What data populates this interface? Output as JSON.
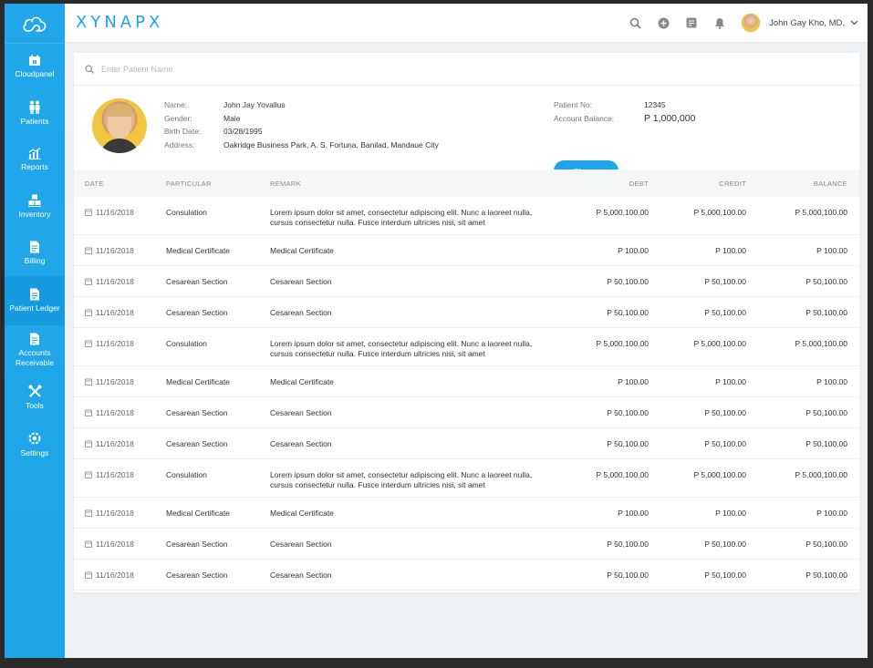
{
  "app": {
    "brand": "XYNAPX"
  },
  "sidebar": {
    "items": [
      {
        "label": "Cloudpanel",
        "icon": "cloudpanel-icon"
      },
      {
        "label": "Patients",
        "icon": "patients-icon"
      },
      {
        "label": "Reports",
        "icon": "reports-icon"
      },
      {
        "label": "Inventory",
        "icon": "inventory-icon"
      },
      {
        "label": "Billing",
        "icon": "billing-icon"
      },
      {
        "label": "Patient Ledger",
        "icon": "ledger-icon"
      },
      {
        "label": "Accounts Receivable",
        "icon": "receivable-icon"
      },
      {
        "label": "Tools",
        "icon": "tools-icon"
      },
      {
        "label": "Settings",
        "icon": "settings-icon"
      }
    ],
    "active": "Patient Ledger"
  },
  "header": {
    "user_name": "John Gay Kho, MD."
  },
  "search": {
    "placeholder": "Enter Patient Name"
  },
  "patient": {
    "name_label": "Name:",
    "name": "John Jay Yovallus",
    "gender_label": "Gender:",
    "gender": "Male",
    "birth_label": "Birth Date:",
    "birth_date": "03/28/1995",
    "address_label": "Address:",
    "address": "Oakridge Business Park, A. S. Fortuna, Banilad, Mandaue City",
    "patient_no_label": "Patient No:",
    "patient_no": "12345",
    "balance_label": "Account Balance:",
    "balance": "P 1,000,000",
    "charge_button": "Charge"
  },
  "ledger": {
    "columns": [
      "DATE",
      "PARTICULAR",
      "REMARK",
      "DEBT",
      "CREDIT",
      "BALANCE"
    ],
    "rows": [
      {
        "date": "11/16/2018",
        "particular": "Consulation",
        "remark": "Lorem ipsum dolor sit amet, consectetur adipiscing elit. Nunc a laoreet nulla, cursus consectetur nulla. Fusce interdum ultricies nisi, sit amet",
        "debt": "P 5,000,100.00",
        "credit": "P 5,000,100.00",
        "balance": "P 5,000,100.00"
      },
      {
        "date": "11/16/2018",
        "particular": "Medical Certificate",
        "remark": "Medical Certificate",
        "debt": "P 100.00",
        "credit": "P 100.00",
        "balance": "P 100.00"
      },
      {
        "date": "11/16/2018",
        "particular": "Cesarean Section",
        "remark": "Cesarean Section",
        "debt": "P 50,100.00",
        "credit": "P 50,100.00",
        "balance": "P 50,100.00"
      },
      {
        "date": "11/16/2018",
        "particular": "Cesarean Section",
        "remark": "Cesarean Section",
        "debt": "P 50,100.00",
        "credit": "P 50,100.00",
        "balance": "P 50,100.00"
      },
      {
        "date": "11/16/2018",
        "particular": "Consulation",
        "remark": "Lorem ipsum dolor sit amet, consectetur adipiscing elit. Nunc a laoreet nulla, cursus consectetur nulla. Fusce interdum ultricies nisi, sit amet",
        "debt": "P 5,000,100.00",
        "credit": "P 5,000,100.00",
        "balance": "P 5,000,100.00"
      },
      {
        "date": "11/16/2018",
        "particular": "Medical Certificate",
        "remark": "Medical Certificate",
        "debt": "P 100.00",
        "credit": "P 100.00",
        "balance": "P 100.00"
      },
      {
        "date": "11/16/2018",
        "particular": "Cesarean Section",
        "remark": "Cesarean Section",
        "debt": "P 50,100.00",
        "credit": "P 50,100.00",
        "balance": "P 50,100.00"
      },
      {
        "date": "11/16/2018",
        "particular": "Cesarean Section",
        "remark": "Cesarean Section",
        "debt": "P 50,100.00",
        "credit": "P 50,100.00",
        "balance": "P 50,100.00"
      },
      {
        "date": "11/16/2018",
        "particular": "Consulation",
        "remark": "Lorem ipsum dolor sit amet, consectetur adipiscing elit. Nunc a laoreet nulla, cursus consectetur nulla. Fusce interdum ultricies nisi, sit amet",
        "debt": "P 5,000,100.00",
        "credit": "P 5,000,100.00",
        "balance": "P 5,000,100.00"
      },
      {
        "date": "11/16/2018",
        "particular": "Medical Certificate",
        "remark": "Medical Certificate",
        "debt": "P 100.00",
        "credit": "P 100.00",
        "balance": "P 100.00"
      },
      {
        "date": "11/16/2018",
        "particular": "Cesarean Section",
        "remark": "Cesarean Section",
        "debt": "P 50,100.00",
        "credit": "P 50,100.00",
        "balance": "P 50,100.00"
      },
      {
        "date": "11/16/2018",
        "particular": "Cesarean Section",
        "remark": "Cesarean Section",
        "debt": "P 50,100.00",
        "credit": "P 50,100.00",
        "balance": "P 50,100.00"
      }
    ]
  },
  "colors": {
    "accent": "#1ea5e8",
    "sidebar_active": "#169be0"
  }
}
